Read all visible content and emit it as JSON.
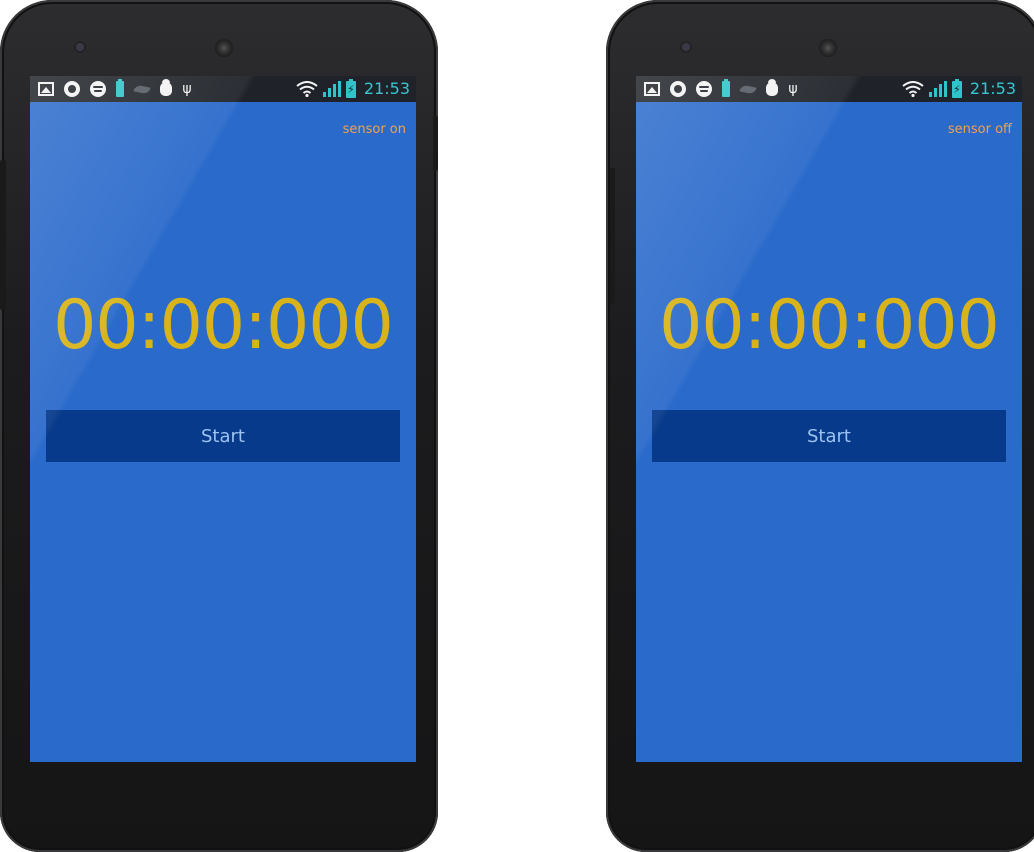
{
  "colors": {
    "screen_bg": "#2a6acb",
    "timer": "#d8b319",
    "sensor_label": "#f0a34a",
    "button_bg": "#073a8a",
    "button_text": "#9cc3f0",
    "clock": "#37c5cf"
  },
  "left_phone": {
    "status_bar": {
      "left_icons": [
        "gallery-icon",
        "app-circle-icon",
        "spotify-icon",
        "battery-icon",
        "leaf-icon",
        "bug-icon",
        "usb-icon"
      ],
      "right_icons": [
        "wifi-icon",
        "signal-icon",
        "battery-charging-icon"
      ],
      "time": "21:53"
    },
    "sensor_status": "sensor on",
    "timer": "00:00:000",
    "start_label": "Start"
  },
  "right_phone": {
    "status_bar": {
      "left_icons": [
        "gallery-icon",
        "app-circle-icon",
        "spotify-icon",
        "battery-icon",
        "leaf-icon",
        "bug-icon",
        "usb-icon"
      ],
      "right_icons": [
        "wifi-icon",
        "signal-icon",
        "battery-charging-icon"
      ],
      "time": "21:53"
    },
    "sensor_status": "sensor off",
    "timer": "00:00:000",
    "start_label": "Start"
  }
}
